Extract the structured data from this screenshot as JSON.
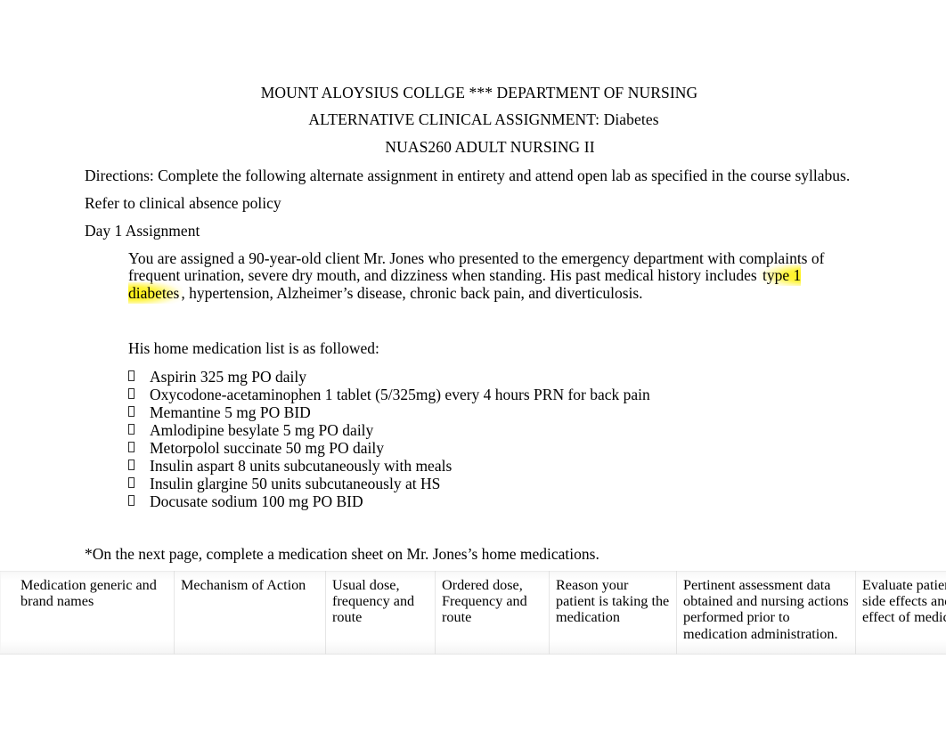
{
  "document": {
    "headings": {
      "line1": "MOUNT ALOYSIUS COLLGE *** DEPARTMENT OF NURSING",
      "line2": "ALTERNATIVE CLINICAL ASSIGNMENT: Diabetes",
      "line3": "NUAS260 ADULT NURSING II"
    },
    "directions": "Directions:   Complete the following alternate assignment in entirety and attend open lab as specified in the course syllabus.",
    "refer_policy": " Refer to clinical absence policy",
    "day_heading": "Day 1 Assignment",
    "scenario": {
      "before_highlight": "You are assigned a 90-year-old client Mr. Jones who presented to the emergency department with complaints of frequent urination, severe dry mouth, and dizziness when standing. His past medical history includes ",
      "highlighted": "type 1 diabetes",
      "after_highlight": ", hypertension, Alzheimer’s disease, chronic back pain, and diverticulosis."
    },
    "medication_intro": "His home medication list is as followed:",
    "medications": [
      "Aspirin 325 mg PO daily",
      "Oxycodone-acetaminophen 1 tablet (5/325mg) every 4 hours PRN for back pain",
      "Memantine 5 mg PO BID",
      "Amlodipine besylate 5 mg PO daily",
      "Metorpolol succinate 50 mg PO daily",
      "Insulin aspart 8 units subcutaneously with meals",
      "Insulin glargine 50 units subcutaneously at HS",
      "Docusate sodium 100 mg PO BID"
    ],
    "footnote": "*On the next page, complete a medication sheet on Mr. Jones’s home medications.",
    "table": {
      "headers": [
        "Medication generic and brand names",
        "Mechanism of Action",
        "Usual dose, frequency and route",
        "Ordered dose, Frequency and route",
        "Reason your patient is taking the medication",
        "Pertinent assessment data obtained and nursing actions performed prior to medication administration.",
        "Evaluate patient responses, side effects and therapeutic effect of medication"
      ]
    },
    "colors": {
      "highlight": "#fff100",
      "text": "#000000",
      "page_background": "#ffffff",
      "table_border": "#e3e3e3"
    }
  }
}
